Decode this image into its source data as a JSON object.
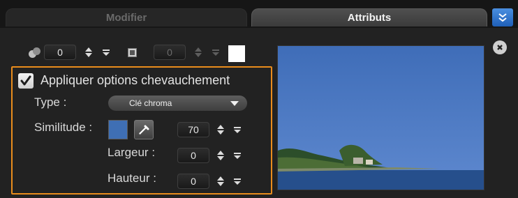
{
  "tabs": [
    {
      "label": "Modifier",
      "active": false
    },
    {
      "label": "Attributs",
      "active": true
    }
  ],
  "toolbar": {
    "shadow_value": "0",
    "border_value": "0",
    "border_color": "#ffffff"
  },
  "overlap": {
    "checkbox_label": "Appliquer options chevauchement",
    "checked": true,
    "type_label": "Type :",
    "type_value": "Clé chroma",
    "similarity_label": "Similitude :",
    "similarity_color": "#3f6fb4",
    "similarity_value": "70",
    "width_label": "Largeur :",
    "width_value": "0",
    "height_label": "Hauteur :",
    "height_value": "0"
  },
  "colors": {
    "highlight_border": "#e98c1c",
    "active_button": "#2f74cf",
    "preview_sky": "#4d77c0",
    "preview_sea": "#2a5590"
  },
  "icons": [
    "double-chevron-down-icon",
    "close-icon",
    "shadow-icon",
    "border-icon",
    "eyedropper-icon",
    "checkmark-icon"
  ]
}
